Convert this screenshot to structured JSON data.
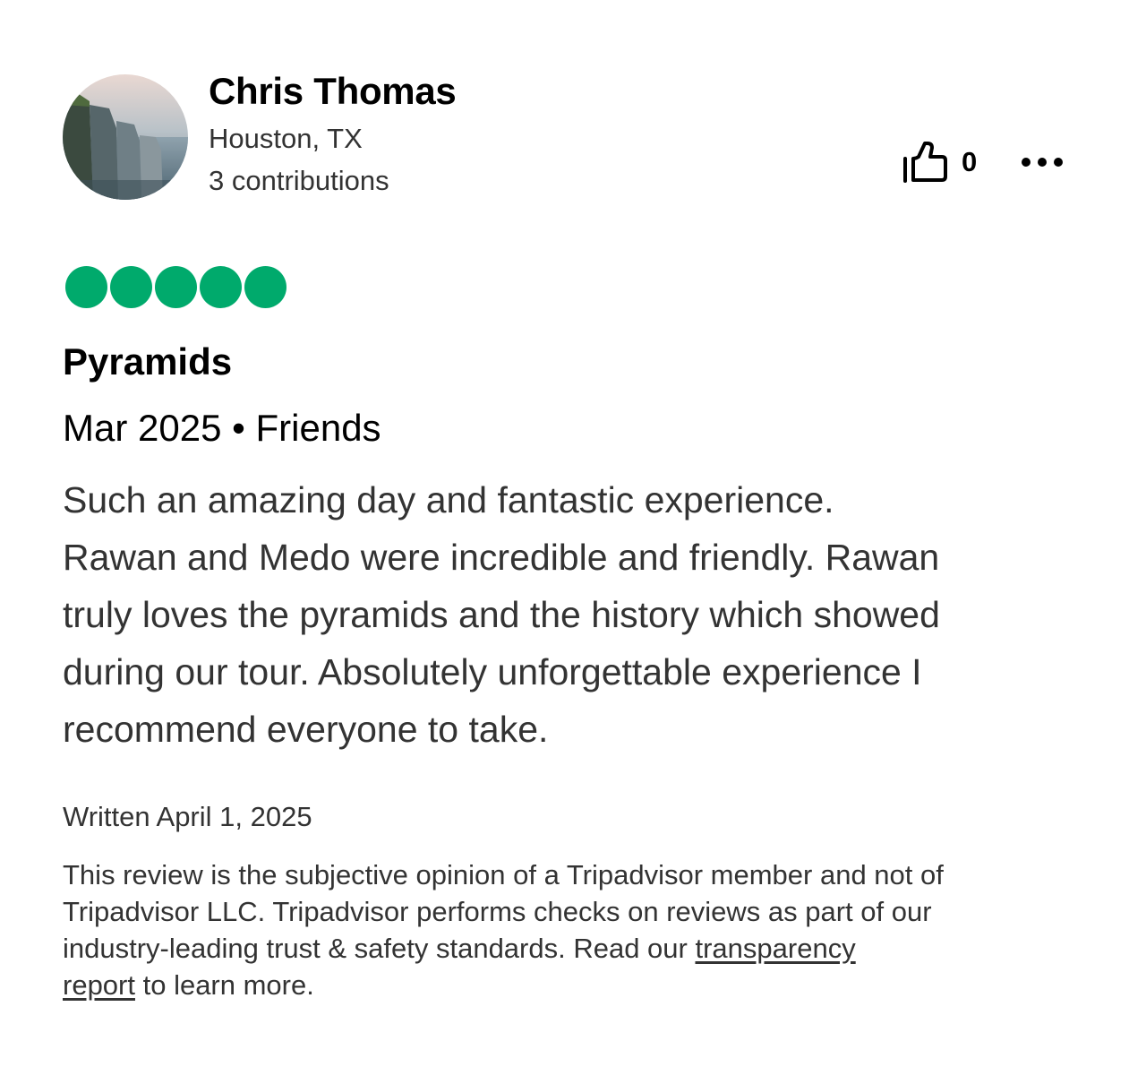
{
  "reviewer": {
    "name": "Chris Thomas",
    "location": "Houston, TX",
    "contributions": "3 contributions"
  },
  "actions": {
    "helpful_count": "0",
    "helpful_icon": "thumbs-up-icon",
    "more_icon": "more-options-icon"
  },
  "rating": {
    "value": 5,
    "max": 5,
    "color": "#00aa6c"
  },
  "review": {
    "title": "Pyramids",
    "date": "Mar 2025",
    "separator": "•",
    "trip_type": "Friends",
    "body_lines": [
      "Such an amazing day and fantastic experience.",
      "Rawan and Medo were incredible and friendly. Rawan",
      "truly loves the pyramids and the history which showed",
      "during our tour. Absolutely unforgettable experience I",
      "recommend everyone to take."
    ],
    "written": "Written April 1, 2025"
  },
  "disclaimer": {
    "line1": "This review is the subjective opinion of a Tripadvisor member and not of",
    "line2": "Tripadvisor LLC. Tripadvisor performs checks on reviews as part of our",
    "line3_text": "industry-leading trust & safety standards. Read our ",
    "link_part1": "transparency",
    "link_part2": "report",
    "line4_text": " to learn more."
  }
}
